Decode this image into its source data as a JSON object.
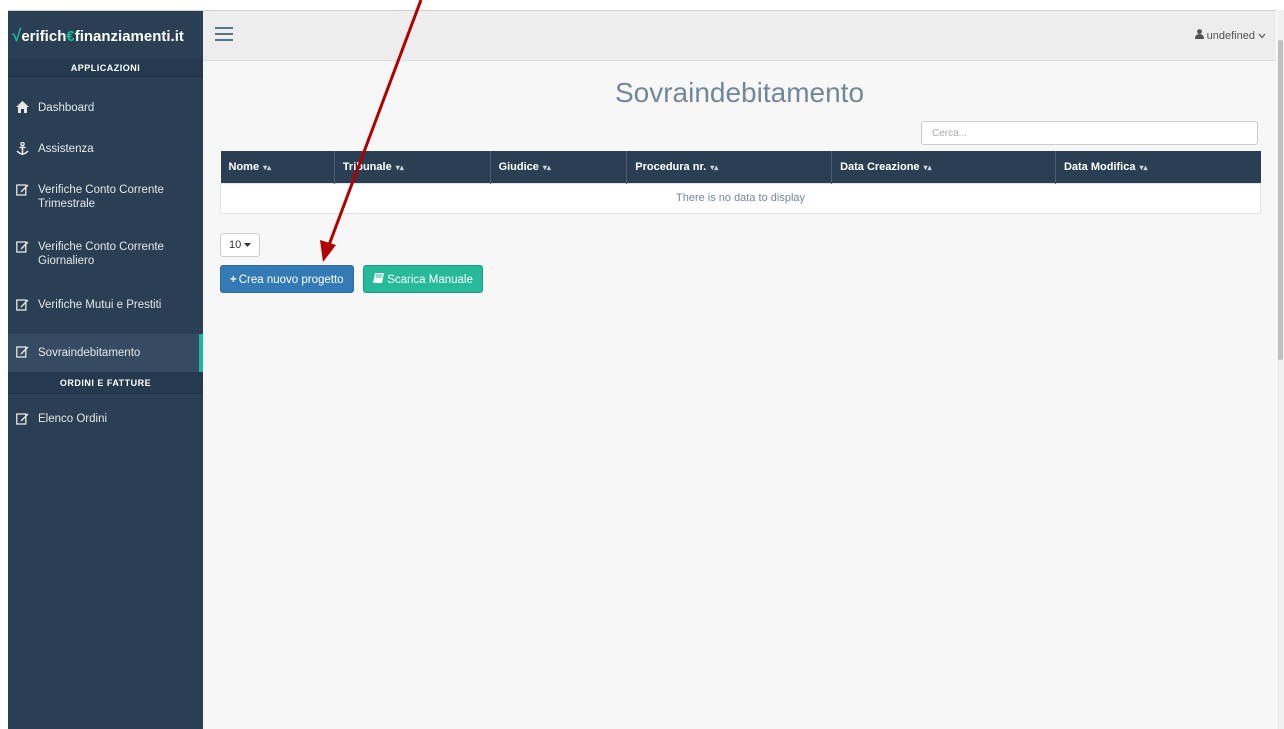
{
  "brand": {
    "check": "√",
    "part1": "erifich",
    "euro": "€",
    "part2": "finanziamenti.it"
  },
  "sidebar": {
    "section1": "APPLICAZIONI",
    "items": [
      {
        "label": "Dashboard",
        "icon": "home-icon"
      },
      {
        "label": "Assistenza",
        "icon": "anchor-icon"
      },
      {
        "label": "Verifiche Conto Corrente Trimestrale",
        "icon": "edit-icon"
      },
      {
        "label": "Verifiche Conto Corrente Giornaliero",
        "icon": "edit-icon"
      },
      {
        "label": "Verifiche Mutui e Prestiti",
        "icon": "edit-icon"
      },
      {
        "label": "Sovraindebitamento",
        "icon": "edit-icon",
        "active": true
      }
    ],
    "section2": "ORDINI E FATTURE",
    "items2": [
      {
        "label": "Elenco Ordini",
        "icon": "edit-icon"
      }
    ]
  },
  "topbar": {
    "user": "undefined"
  },
  "main": {
    "title": "Sovraindebitamento",
    "search_placeholder": "Cerca...",
    "columns": [
      "Nome",
      "Tribunale",
      "Giudice",
      "Procedura nr.",
      "Data Creazione",
      "Data Modifica"
    ],
    "empty_text": "There is no data to display",
    "page_size": "10",
    "create_button": "Crea nuovo progetto",
    "manual_button": "Scarica Manuale"
  },
  "colors": {
    "sidebar": "#2a3f54",
    "accent": "#1abb9c",
    "primary": "#337ab7",
    "success": "#26b99a",
    "annotation_arrow": "#b00000"
  }
}
